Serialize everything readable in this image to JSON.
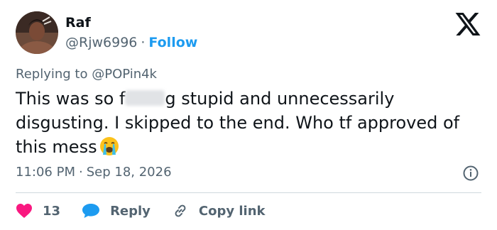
{
  "author": {
    "name": "Raf",
    "handle": "@Rjw6996",
    "separator": "·",
    "follow_label": "Follow"
  },
  "reply_context": {
    "prefix": "Replying to",
    "mention": "@POPin4k"
  },
  "tweet": {
    "text_part1": "This was so f",
    "text_part2": "g stupid and unnecessarily disgusting. I skipped to the end. Who tf approved of this mess",
    "emoji_name": "loudly-crying-face"
  },
  "meta": {
    "time": "11:06 PM",
    "separator": "·",
    "date": "Sep 18, 2026"
  },
  "actions": {
    "like_count": "13",
    "reply_label": "Reply",
    "copy_link_label": "Copy link"
  },
  "colors": {
    "like": "#f91880",
    "reply": "#1d9bf0",
    "follow": "#1d9bf0",
    "secondary_text": "#536471"
  }
}
